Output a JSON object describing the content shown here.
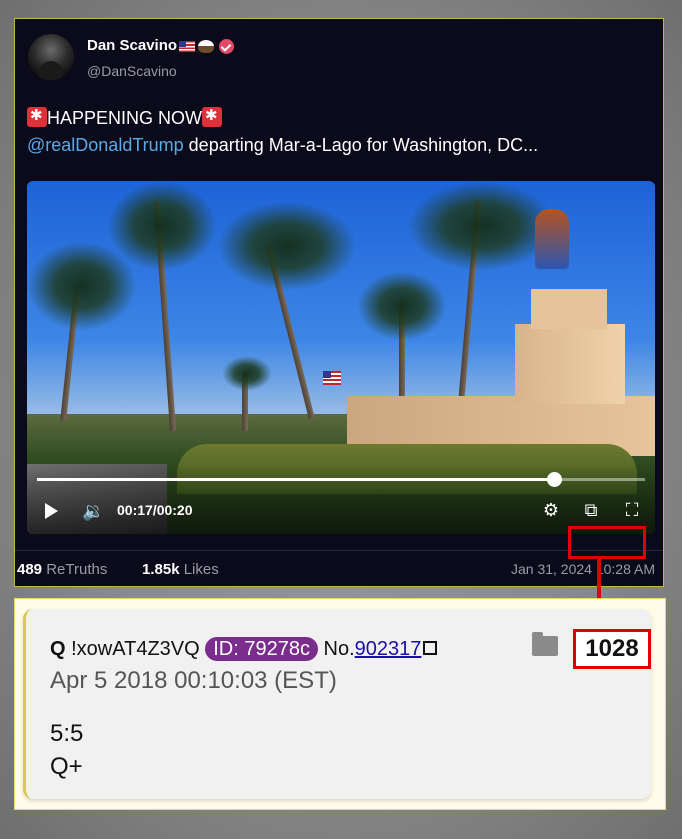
{
  "post": {
    "author_name": "Dan Scavino",
    "handle": "@DanScavino",
    "headline": "HAPPENING NOW",
    "mention": "@realDonaldTrump",
    "text": " departing Mar-a-Lago for Washington, DC...",
    "video": {
      "time": "00:17/00:20",
      "progress": 0.85
    },
    "retruths_count": "489",
    "retruths_label": "ReTruths",
    "likes_count": "1.85k",
    "likes_label": "Likes",
    "date": "Jan 31, 2024",
    "time": "10:28 AM"
  },
  "qpost": {
    "name": "Q",
    "tripcode": "!xowAT4Z3VQ",
    "id_label": "ID: 79278c",
    "no_label": "No.",
    "no_value": "902317",
    "number": "1028",
    "date": "Apr 5 2018 00:10:03 (EST)",
    "body_line1": "5:5",
    "body_line2": "Q+"
  },
  "colors": {
    "highlight": "#e00000",
    "mention": "#5aa9e6",
    "id_badge": "#7b2d8e",
    "verified": "#e44868"
  },
  "icons": [
    "flag-icon",
    "eagle-icon",
    "verified-icon",
    "siren-icon",
    "play-icon",
    "volume-icon",
    "settings-icon",
    "pip-icon",
    "fullscreen-icon",
    "external-link-icon",
    "folder-icon"
  ]
}
